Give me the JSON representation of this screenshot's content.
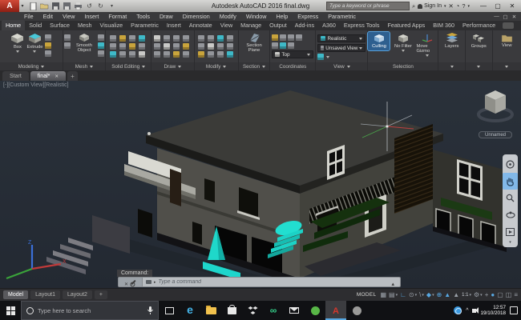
{
  "colors": {
    "accent_blue": "#57a0da",
    "accent_cyan": "#22ded0",
    "viewport_bg": "#262c33",
    "autocad_red": "#c21e1e"
  },
  "title_bar": {
    "title": "Autodesk AutoCAD 2016   final.dwg",
    "search_placeholder": "Type a keyword or phrase",
    "sign_in_label": "Sign In"
  },
  "menu": {
    "items": [
      "File",
      "Edit",
      "View",
      "Insert",
      "Format",
      "Tools",
      "Draw",
      "Dimension",
      "Modify",
      "Window",
      "Help",
      "Express",
      "Parametric"
    ]
  },
  "ribbon": {
    "tabs": [
      "Home",
      "Solid",
      "Surface",
      "Mesh",
      "Visualize",
      "Parametric",
      "Insert",
      "Annotate",
      "View",
      "Manage",
      "Output",
      "Add-ins",
      "A360",
      "Express Tools",
      "Featured Apps",
      "BIM 360",
      "Performance"
    ],
    "active_tab": "Home",
    "buttons": {
      "box": "Box",
      "extrude": "Extrude",
      "smooth_object": "Smooth Object",
      "section_plane": "Section Plane",
      "culling": "Culling",
      "no_filter": "No Filter",
      "move_gizmo": "Move Gizmo",
      "layers": "Layers",
      "groups": "Groups",
      "view": "View"
    },
    "dropdowns": {
      "visual_style": "Realistic",
      "view_state": "Unsaved View",
      "ucs": "Top"
    },
    "panel_labels": {
      "modeling": "Modeling",
      "mesh": "Mesh",
      "solid_editing": "Solid Editing",
      "draw": "Draw",
      "modify": "Modify",
      "section": "Section",
      "coordinates": "Coordinates",
      "view": "View",
      "selection": "Selection"
    }
  },
  "file_tabs": {
    "start": "Start",
    "current": "final*"
  },
  "viewport": {
    "corner_label": "[-][Custom View][Realistic]",
    "viewcube_label": "Unnamed",
    "ucs": {
      "z": "Z",
      "x": "X"
    }
  },
  "command_line": {
    "history_line": "Command:",
    "input_placeholder": "Type a command"
  },
  "status_bar": {
    "layout_tabs": {
      "model": "Model",
      "layout1": "Layout1",
      "layout2": "Layout2"
    },
    "space_label": "MODEL",
    "scale_label": "1:1"
  },
  "taskbar": {
    "search_placeholder": "Type here to search",
    "clock_time": "12:57",
    "clock_date": "19/10/2018"
  }
}
